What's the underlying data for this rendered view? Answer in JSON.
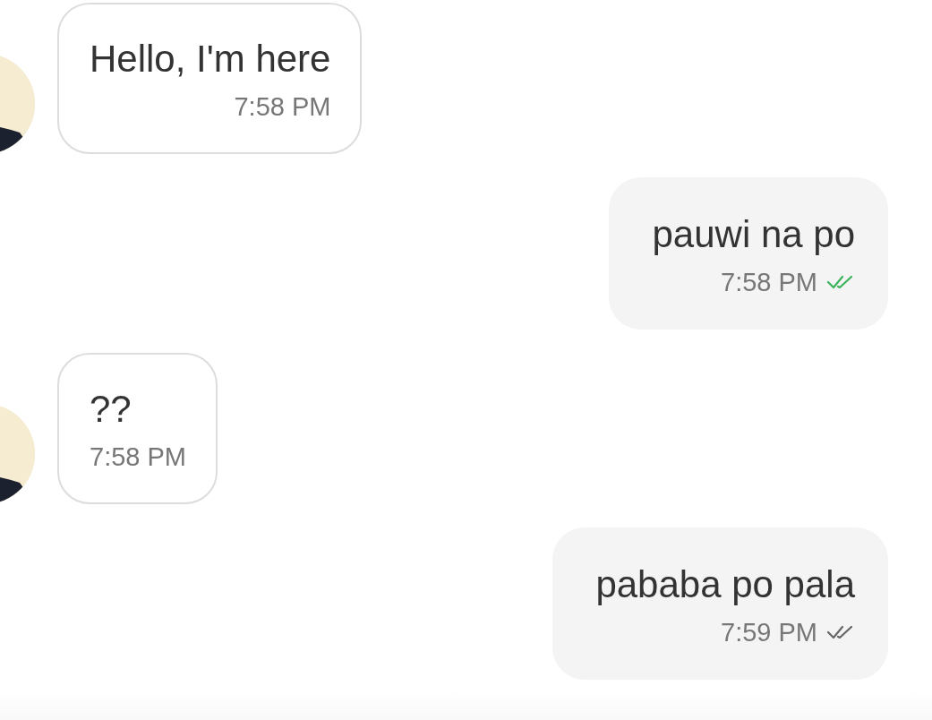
{
  "messages": [
    {
      "kind": "incoming",
      "text": "Hello, I'm here",
      "time": "7:58 PM"
    },
    {
      "kind": "outgoing",
      "text": "pauwi na po",
      "time": "7:58 PM",
      "read": true
    },
    {
      "kind": "incoming",
      "text": "??",
      "time": "7:58 PM"
    },
    {
      "kind": "outgoing",
      "text": "pababa po pala",
      "time": "7:59 PM",
      "read": false
    }
  ]
}
